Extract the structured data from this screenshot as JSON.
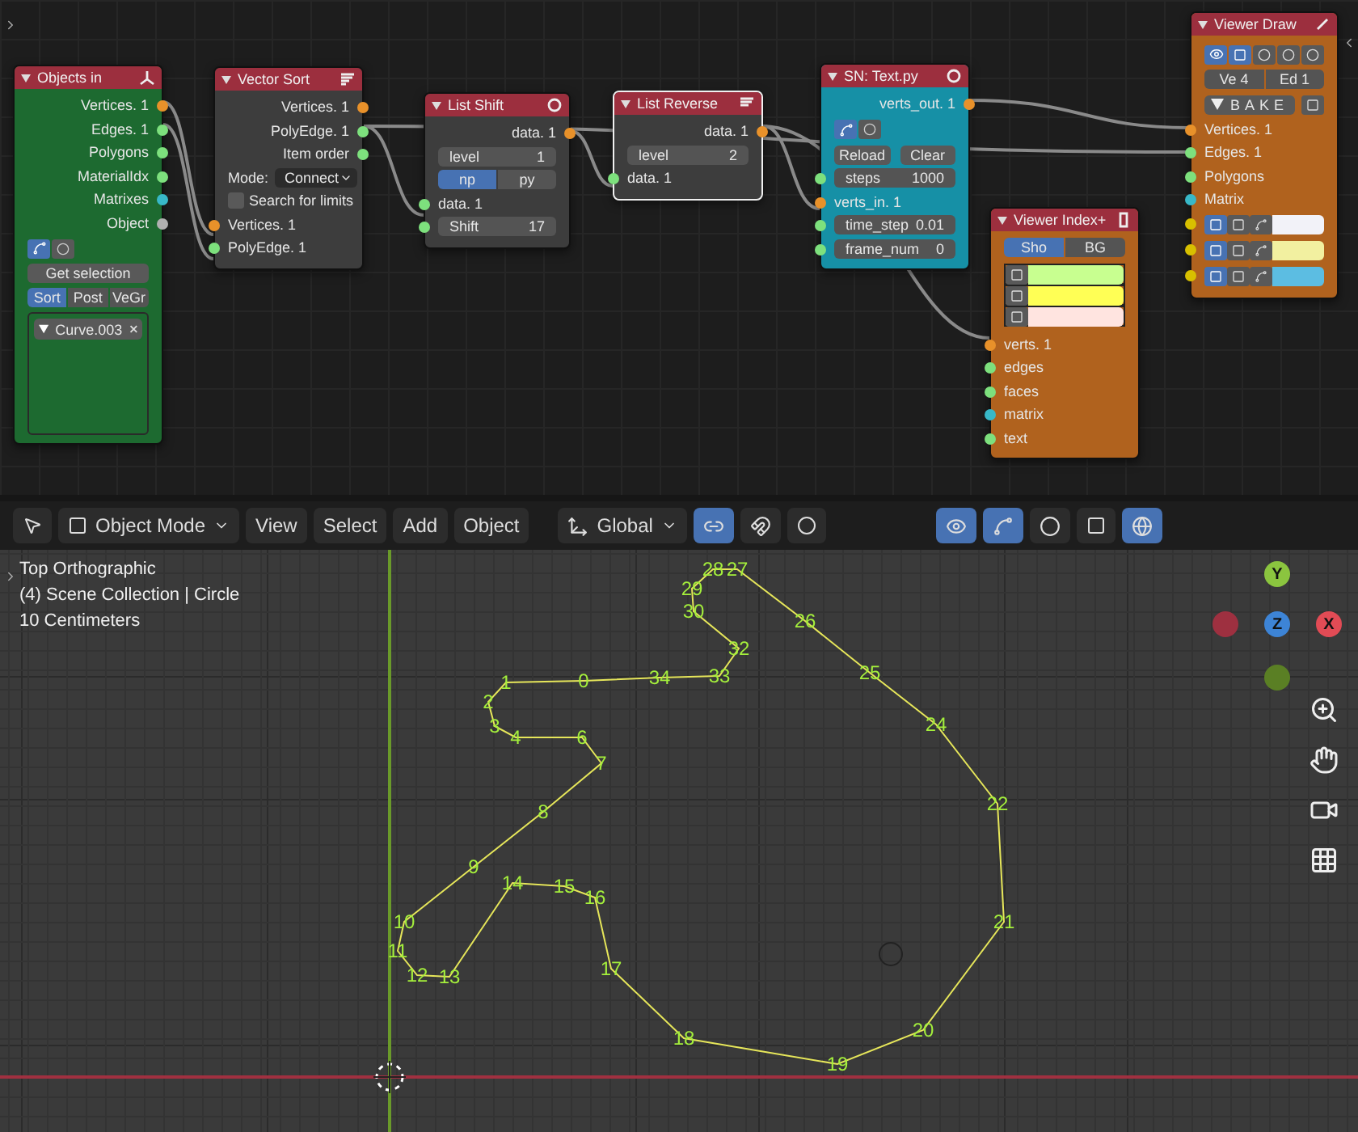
{
  "node_editor": {
    "nodes": [
      {
        "title": "Objects in",
        "color": "#1d6a30",
        "selected": false,
        "rows": [
          {
            "kind": "output",
            "label": "Vertices. 1",
            "color": "#e8912a"
          },
          {
            "kind": "output",
            "label": "Edges. 1",
            "color": "#7de07d"
          },
          {
            "kind": "output",
            "label": "Polygons",
            "color": "#7de07d"
          },
          {
            "kind": "output",
            "label": "MaterialIdx",
            "color": "#7de07d"
          },
          {
            "kind": "output",
            "label": "Matrixes",
            "color": "#38b8c8"
          },
          {
            "kind": "output",
            "label": "Object",
            "color": "#b0b0b0"
          },
          {
            "kind": "icon_toggles"
          },
          {
            "kind": "button",
            "label": "Get selection"
          },
          {
            "kind": "segmented",
            "options": [
              {
                "label": "Sort",
                "selected": true
              },
              {
                "label": "Post",
                "selected": false
              },
              {
                "label": "VeGr",
                "selected": false
              }
            ]
          },
          {
            "kind": "list",
            "items": [
              "Curve.003"
            ]
          }
        ]
      },
      {
        "title": "Vector Sort",
        "color": "#3d3d3d",
        "selected": false,
        "rows": [
          {
            "kind": "output",
            "label": "Vertices. 1",
            "color": "#e8912a"
          },
          {
            "kind": "output",
            "label": "PolyEdge. 1",
            "color": "#7de07d"
          },
          {
            "kind": "output",
            "label": "Item order",
            "color": "#7de07d"
          },
          {
            "kind": "dropdown",
            "label": "Mode:",
            "value": "Connect"
          },
          {
            "kind": "checkbox",
            "label": "Search for limits",
            "checked": false
          },
          {
            "kind": "input",
            "label": "Vertices. 1",
            "color": "#e8912a"
          },
          {
            "kind": "input",
            "label": "PolyEdge. 1",
            "color": "#7de07d"
          }
        ]
      },
      {
        "title": "List Shift",
        "color": "#3d3d3d",
        "selected": false,
        "rows": [
          {
            "kind": "output",
            "label": "data. 1",
            "color": "#e8912a"
          },
          {
            "kind": "field",
            "label": "level",
            "value": "1"
          },
          {
            "kind": "segmented",
            "options": [
              {
                "label": "np",
                "selected": true
              },
              {
                "label": "py",
                "selected": false
              }
            ]
          },
          {
            "kind": "input",
            "label": "data. 1",
            "color": "#7de07d"
          },
          {
            "kind": "input_field",
            "label": "Shift",
            "value": "17",
            "color": "#7de07d"
          }
        ]
      },
      {
        "title": "List Reverse",
        "color": "#3d3d3d",
        "selected": true,
        "rows": [
          {
            "kind": "output",
            "label": "data. 1",
            "color": "#e8912a"
          },
          {
            "kind": "field",
            "label": "level",
            "value": "2"
          },
          {
            "kind": "input",
            "label": "data. 1",
            "color": "#7de07d"
          }
        ]
      },
      {
        "title": "SN: Text.py",
        "color": "#1690a6",
        "selected": false,
        "rows": [
          {
            "kind": "output",
            "label": "verts_out. 1",
            "color": "#e8912a"
          },
          {
            "kind": "icon_toggles"
          },
          {
            "kind": "buttons",
            "labels": [
              "Reload",
              "Clear"
            ]
          },
          {
            "kind": "input_field",
            "label": "steps",
            "value": "1000",
            "color": "#7de07d"
          },
          {
            "kind": "input",
            "label": "verts_in. 1",
            "color": "#e8912a"
          },
          {
            "kind": "input_field",
            "label": "time_step",
            "value": "0.01",
            "color": "#7de07d"
          },
          {
            "kind": "input_field",
            "label": "frame_num",
            "value": "0",
            "color": "#7de07d"
          }
        ]
      },
      {
        "title": "Viewer Index+",
        "color": "#b0621e",
        "selected": false,
        "rows": [
          {
            "kind": "segmented",
            "options": [
              {
                "label": "Sho",
                "selected": true
              },
              {
                "label": "BG",
                "selected": false
              }
            ]
          },
          {
            "kind": "swatches",
            "items": [
              {
                "color": "#c8ff90"
              },
              {
                "color": "#ffff55"
              },
              {
                "color": "#ffe4e0"
              }
            ]
          },
          {
            "kind": "input",
            "label": "verts. 1",
            "color": "#e8912a"
          },
          {
            "kind": "input",
            "label": "edges",
            "color": "#7de07d"
          },
          {
            "kind": "input",
            "label": "faces",
            "color": "#7de07d"
          },
          {
            "kind": "input",
            "label": "matrix",
            "color": "#38b8c8"
          },
          {
            "kind": "input",
            "label": "text",
            "color": "#7de07d"
          }
        ]
      },
      {
        "title": "Viewer Draw",
        "color": "#b0621e",
        "selected": false,
        "rows": [
          {
            "kind": "display_icons"
          },
          {
            "kind": "segmented",
            "options": [
              {
                "label": "Ve  4",
                "selected": false
              },
              {
                "label": "Ed  1",
                "selected": false
              }
            ]
          },
          {
            "kind": "bake",
            "label": "BAKE"
          },
          {
            "kind": "input",
            "label": "Vertices. 1",
            "color": "#e8912a"
          },
          {
            "kind": "input",
            "label": "Edges. 1",
            "color": "#7de07d"
          },
          {
            "kind": "input",
            "label": "Polygons",
            "color": "#7de07d"
          },
          {
            "kind": "input",
            "label": "Matrix",
            "color": "#38b8c8"
          },
          {
            "kind": "color_inputs",
            "items": [
              {
                "color": "#f2f2f8"
              },
              {
                "color": "#f2f0a0"
              },
              {
                "color": "#5cbde2"
              }
            ]
          }
        ]
      }
    ]
  },
  "viewport": {
    "header": {
      "mode": "Object Mode",
      "menus": [
        "View",
        "Select",
        "Add",
        "Object"
      ],
      "orientation": "Global",
      "toggles": [
        {
          "selected": false
        },
        {
          "selected": true
        },
        {
          "selected": false
        },
        {
          "selected": false
        },
        {
          "selected": true
        },
        {
          "selected": true
        },
        {
          "selected": false
        },
        {
          "selected": false
        },
        {
          "selected": true
        }
      ]
    },
    "overlay_text": [
      "Top Orthographic",
      "(4) Scene Collection | Circle",
      "10 Centimeters"
    ],
    "gizmo": [
      "Y",
      "Z",
      "X"
    ],
    "vertex_labels": [
      "28",
      "27",
      "29",
      "30",
      "26",
      "32",
      "1",
      "0",
      "34",
      "33",
      "25",
      "2",
      "3",
      "24",
      "4",
      "6",
      "7",
      "8",
      "22",
      "9",
      "14",
      "15",
      "16",
      "10",
      "21",
      "11",
      "12",
      "13",
      "17",
      "18",
      "20",
      "19"
    ]
  }
}
